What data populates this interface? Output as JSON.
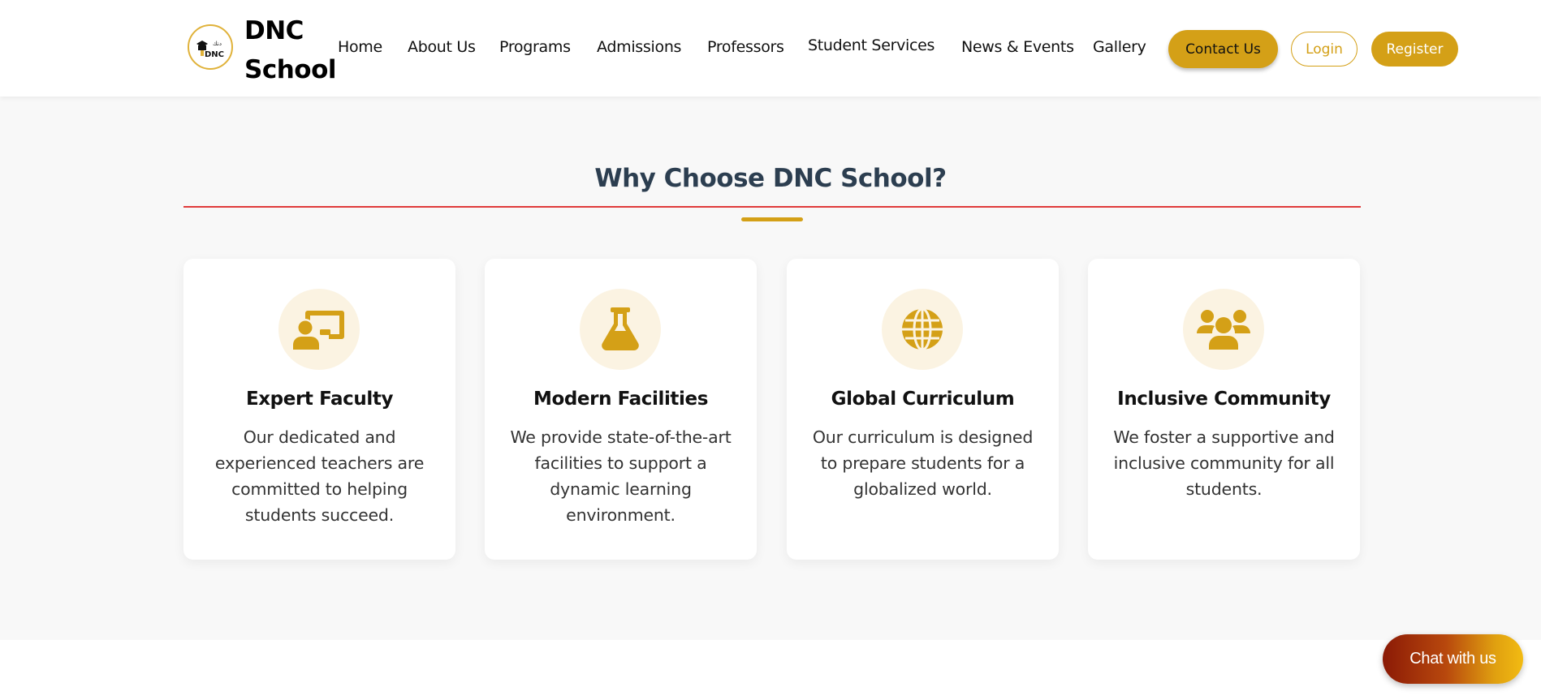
{
  "brand": {
    "name_line1": "DNC",
    "name_line2": "School"
  },
  "nav": {
    "links": [
      "Home",
      "About Us",
      "Programs",
      "Admissions",
      "Professors",
      "Student Services",
      "News & Events",
      "Gallery"
    ],
    "contact_label": "Contact Us",
    "login_label": "Login",
    "register_label": "Register"
  },
  "section": {
    "title": "Why Choose DNC School?",
    "cards": [
      {
        "icon": "teacher-board-icon",
        "title": "Expert Faculty",
        "text": "Our dedicated and experienced teachers are committed to helping students succeed."
      },
      {
        "icon": "flask-icon",
        "title": "Modern Facilities",
        "text": "We provide state-of-the-art facilities to support a dynamic learning environment."
      },
      {
        "icon": "globe-icon",
        "title": "Global Curriculum",
        "text": "Our curriculum is designed to prepare students for a globalized world."
      },
      {
        "icon": "users-icon",
        "title": "Inclusive Community",
        "text": "We foster a supportive and inclusive community for all students."
      }
    ]
  },
  "chat": {
    "label": "Chat with us"
  },
  "colors": {
    "accent": "#d4a017",
    "title": "#2c3e50",
    "rule": "#e03b3b",
    "icon_bg": "#fbf3e2",
    "section_bg": "#f8f8f8"
  }
}
